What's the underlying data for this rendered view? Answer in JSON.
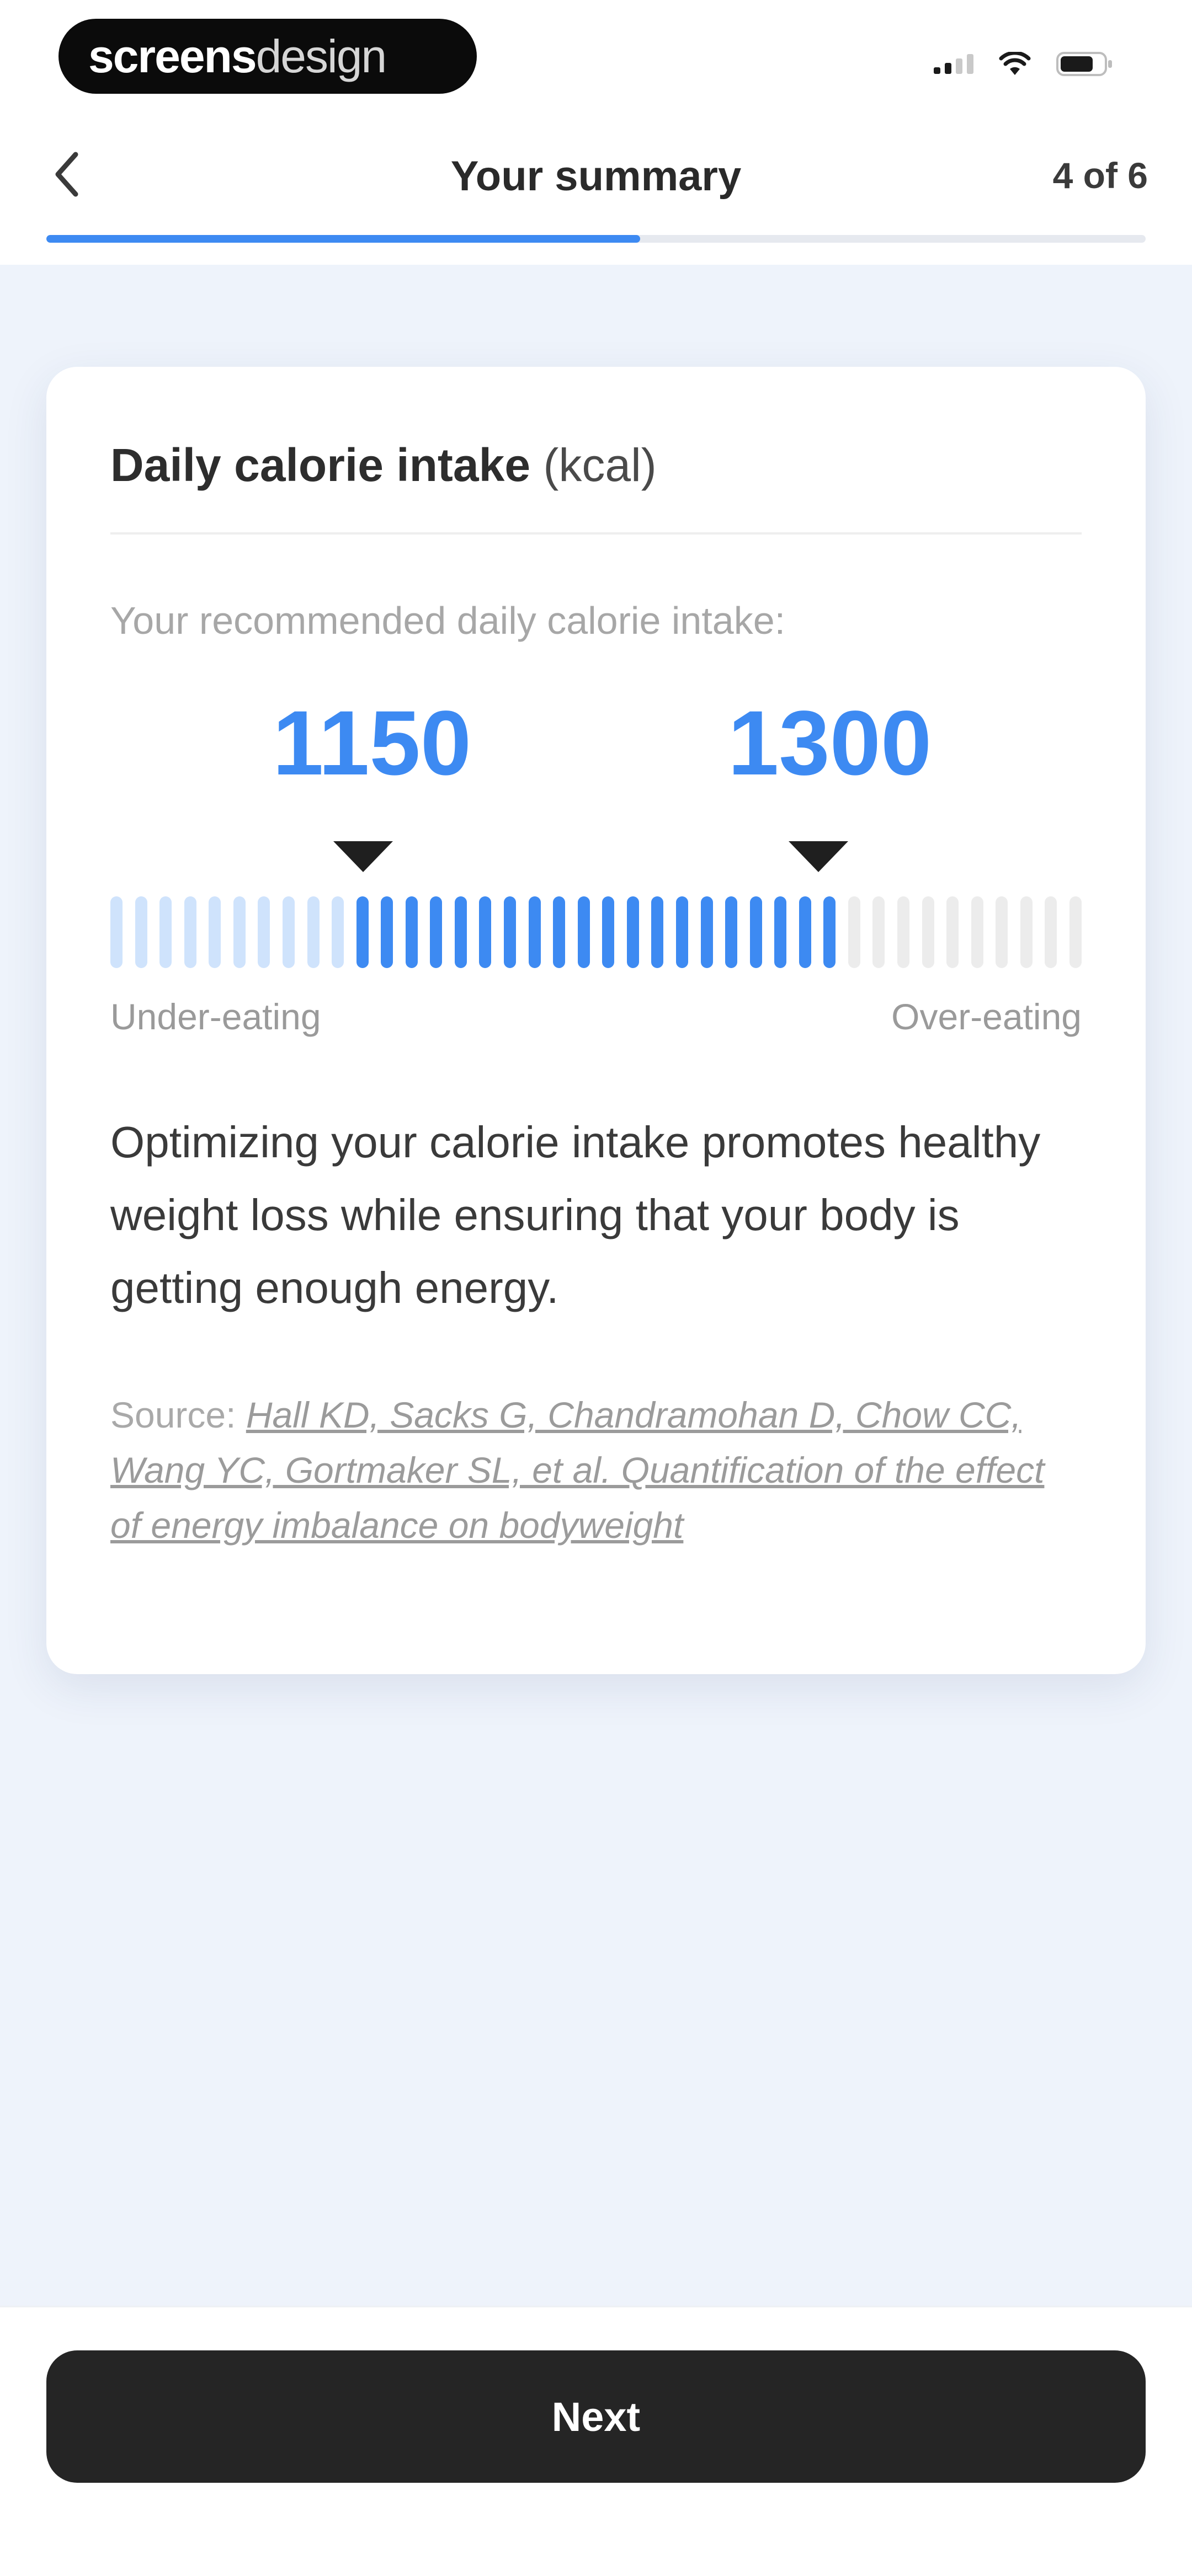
{
  "status_bar": {
    "brand_strong": "screens",
    "brand_light": "design",
    "icons": [
      "signal-icon",
      "wifi-icon",
      "battery-icon"
    ]
  },
  "header": {
    "back_icon": "chevron-left-icon",
    "title": "Your summary",
    "step_counter": "4 of 6",
    "progress_fraction": 0.54,
    "accent_color": "#3d8af2"
  },
  "card": {
    "title": "Daily calorie intake",
    "title_unit": "(kcal)",
    "recommend_label": "Your recommended daily calorie intake:",
    "range": {
      "min_value": "1150",
      "max_value": "1300"
    },
    "scale": {
      "tick_count": 40,
      "low_band_ticks": 10,
      "target_band_ticks": 20,
      "high_band_ticks": 10,
      "colors": {
        "low": "#cfe3fc",
        "target": "#3d8af2",
        "high": "#ececec"
      }
    },
    "scale_left_label": "Under-eating",
    "scale_right_label": "Over-eating",
    "info_text": "Optimizing your calorie intake promotes healthy weight loss while ensuring that your body is getting enough energy.",
    "source_prefix": "Source:",
    "source_link_text": "Hall KD, Sacks G, Chandramohan D, Chow CC, Wang YC, Gortmaker SL, et al. Quantification of the effect of energy imbalance on bodyweight"
  },
  "footer": {
    "next_label": "Next"
  }
}
